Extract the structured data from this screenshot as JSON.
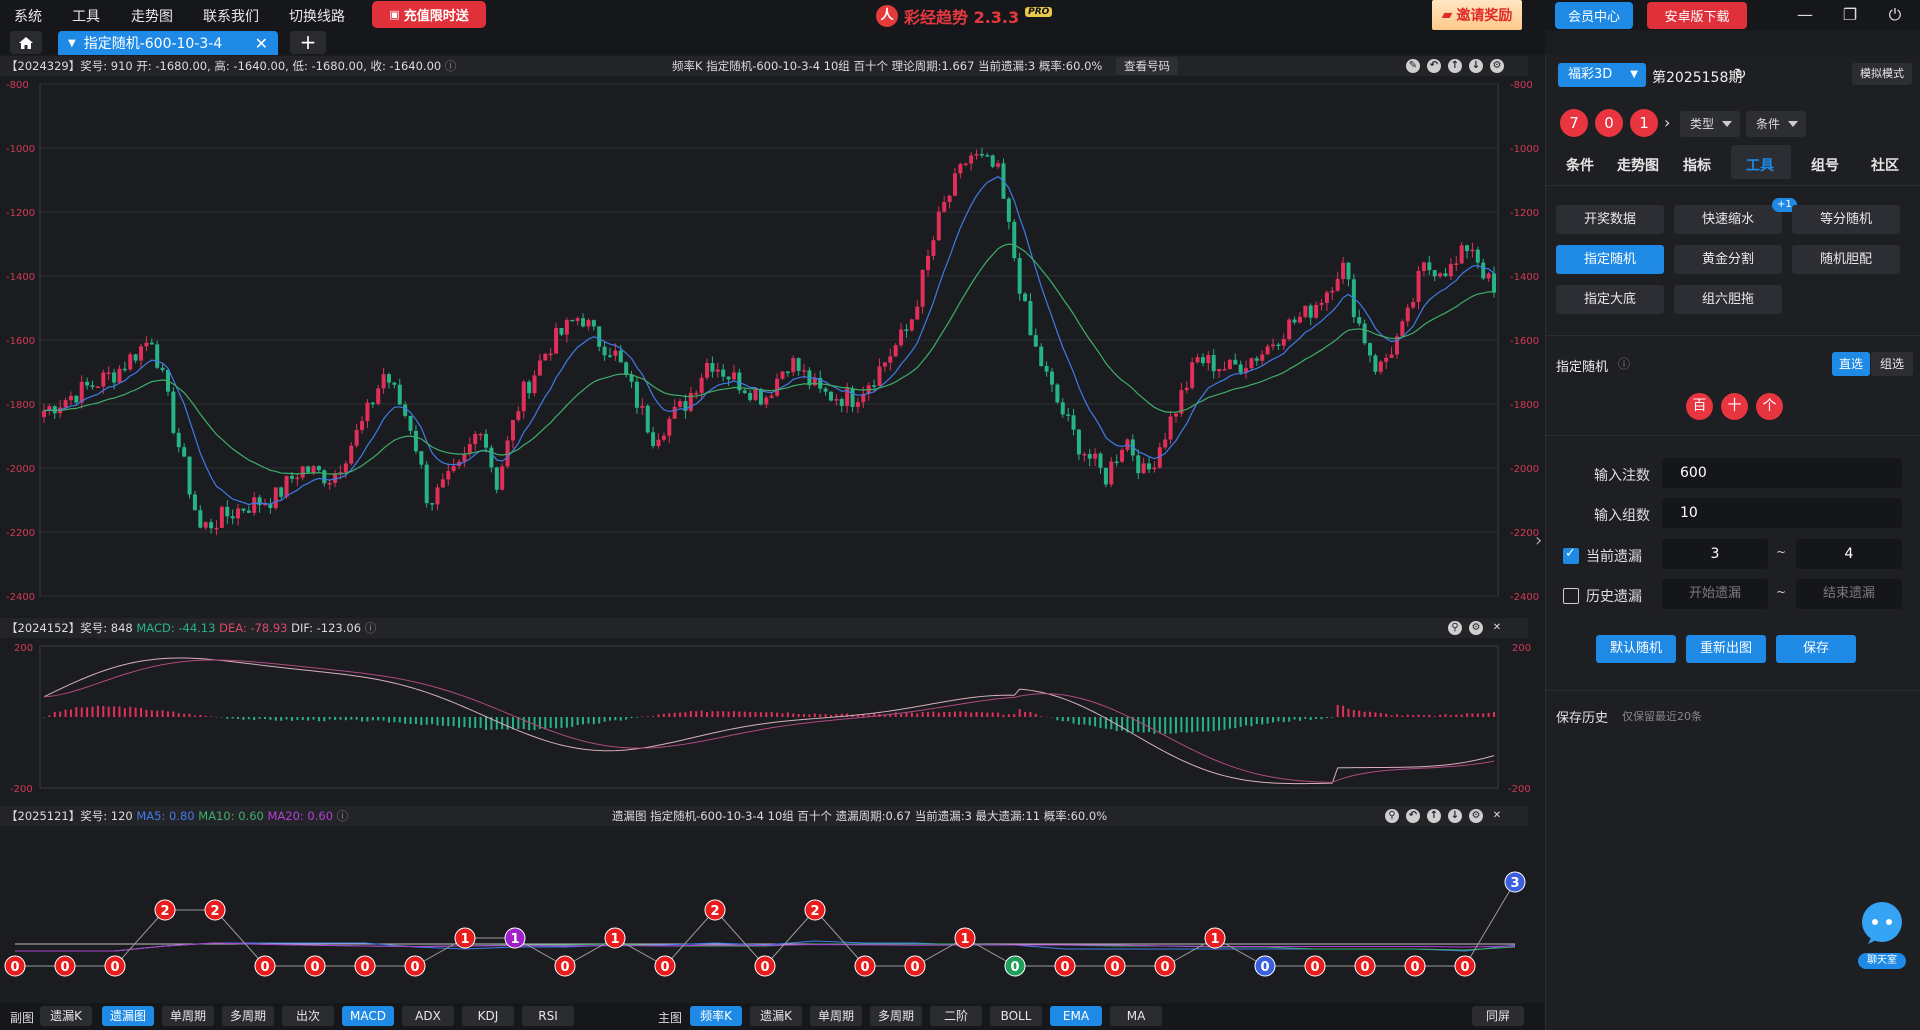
{
  "menu": [
    "系统",
    "工具",
    "走势图",
    "联系我们",
    "切换线路"
  ],
  "promo_label": "充值限时送",
  "app": {
    "name": "彩经趋势 2.3.3",
    "badge": "PRO"
  },
  "invite_label": "邀请奖励",
  "member_label": "会员中心",
  "android_label": "安卓版下载",
  "tab": {
    "label": "指定随机-600-10-3-4"
  },
  "kline": {
    "info_left": "【2024329】奖号: 910  开: -1680.00, 高: -1640.00, 低: -1680.00, 收: -1640.00",
    "info_mid": "频率K   指定随机-600-10-3-4   10组   百十个   理论周期:1.667   当前遗漏:3   概率:60.0%",
    "check_label": "查看号码",
    "y_ticks": [
      "-800",
      "-1000",
      "-1200",
      "-1400",
      "-1600",
      "-1800",
      "-2000",
      "-2200",
      "-2400"
    ]
  },
  "macd": {
    "period": "【2024152】奖号: 848",
    "macd_label": "MACD: -44.13",
    "dea_label": "DEA: -78.93",
    "dif_label": "DIF: -123.06",
    "y_ticks": [
      "200",
      "-200"
    ]
  },
  "miss": {
    "info_left": "【2025121】奖号: 120",
    "ma5": "MA5: 0.80",
    "ma10": "MA10: 0.60",
    "ma20": "MA20: 0.60",
    "info_mid": "遗漏图   指定随机-600-10-3-4   10组   百十个   遗漏周期:0.67   当前遗漏:3   最大遗漏:11   概率:60.0%",
    "values": [
      0,
      0,
      0,
      2,
      2,
      0,
      0,
      0,
      0,
      1,
      1,
      0,
      1,
      0,
      2,
      0,
      2,
      0,
      0,
      1,
      0,
      0,
      0,
      0,
      1,
      0,
      0,
      0,
      0,
      0,
      3
    ]
  },
  "bottom": {
    "sub_label": "副图",
    "sub_buttons": [
      "遗漏K",
      "遗漏图",
      "单周期",
      "多周期",
      "出次",
      "MACD",
      "ADX",
      "KDJ",
      "RSI"
    ],
    "main_label": "主图",
    "main_buttons": [
      "频率K",
      "遗漏K",
      "单周期",
      "多周期",
      "二阶",
      "BOLL",
      "EMA",
      "MA"
    ],
    "sync_label": "同屏"
  },
  "sidebar": {
    "lottery": "福彩3D",
    "issue": "第2025158期",
    "mode": "模拟模式",
    "balls": [
      "7",
      "0",
      "1"
    ],
    "type_select": "类型",
    "cond_select": "条件",
    "tabs": [
      "条件",
      "走势图",
      "指标",
      "工具",
      "组号",
      "社区"
    ],
    "tools": [
      "开奖数据",
      "快速缩水",
      "等分随机",
      "指定随机",
      "黄金分割",
      "随机胆配",
      "指定大底",
      "组六胆拖"
    ],
    "tool_badge": "+1",
    "section_title": "指定随机",
    "direct_label": "直选",
    "group_label": "组选",
    "positions": [
      "百",
      "十",
      "个"
    ],
    "bets_label": "输入注数",
    "bets_value": "600",
    "groups_label": "输入组数",
    "groups_value": "10",
    "current_miss_label": "当前遗漏",
    "current_miss_from": "3",
    "current_miss_to": "4",
    "history_miss_label": "历史遗漏",
    "history_from_placeholder": "开始遗漏",
    "history_to_placeholder": "结束遗漏",
    "tilde": "~",
    "btn_default": "默认随机",
    "btn_redraw": "重新出图",
    "btn_save": "保存",
    "history_title": "保存历史",
    "history_note": "仅保留最近20条",
    "chat_label": "聊天室"
  },
  "colors": {
    "accent": "#1e8ae6",
    "red": "#e8353f",
    "up": "#e0305a",
    "down": "#27b386"
  }
}
